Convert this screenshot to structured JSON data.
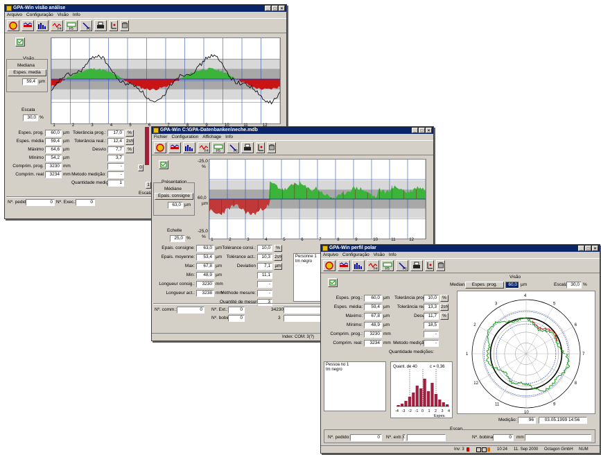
{
  "colors": {
    "title_bg": "#0a246a",
    "positive_fill": "#3cb43c",
    "negative_fill": "#c81414",
    "band_dark": "#a8a8a8",
    "band_light": "#d8d8d8",
    "line": "#101010"
  },
  "win1": {
    "title": "GPA-Win visão análise",
    "window_buttons": [
      "_",
      "□",
      "×"
    ],
    "menu": [
      "Arquivo",
      "Configuração",
      "Visão",
      "Info"
    ],
    "toolbar_icons": [
      "analysis-icon",
      "profile-icon",
      "bar-chart-icon",
      "f4-profile-icon",
      "f5-icon",
      "f6-icon",
      "print-icon",
      "axis-icon",
      "database-icon"
    ],
    "view_group": {
      "title": "Visão",
      "mode": "Mediana",
      "button": "Espes. media",
      "value": "59,4",
      "unit": "µm"
    },
    "scale": {
      "label": "Escala",
      "value": "30,0",
      "unit": "%"
    },
    "x_ticks": [
      "1",
      "2",
      "3",
      "4",
      "5",
      "6",
      "7",
      "8",
      "9",
      "10",
      "11",
      "12"
    ],
    "stats_left": [
      {
        "label": "Espes. prog.",
        "value": "60,0",
        "unit": "µm"
      },
      {
        "label": "Espes. média",
        "value": "59,4",
        "unit": "µm"
      },
      {
        "label": "Máximo",
        "value": "64,6",
        "unit": "µm"
      },
      {
        "label": "Mínimo",
        "value": "54,2",
        "unit": "µm"
      },
      {
        "label": "Comprim. prog.",
        "value": "3230",
        "unit": "mm"
      },
      {
        "label": "Comprim. real",
        "value": "3234",
        "unit": "mm"
      }
    ],
    "stats_right": [
      {
        "label": "Tolerância prog.:",
        "value": "17,0",
        "unit": "%"
      },
      {
        "label": "Tolerância real.:",
        "value": "12,4",
        "unit": "2s%"
      },
      {
        "label": "Desvio",
        "value": "7,7",
        "unit": "%"
      },
      {
        "label": "",
        "value": "3,7",
        "unit": ""
      },
      {
        "label": "",
        "value": "-",
        "unit": ""
      },
      {
        "label": "Metodo medição:",
        "value": "-",
        "unit": ""
      },
      {
        "label": "Quantidade medições:",
        "value": "1",
        "unit": ""
      }
    ],
    "bottom": {
      "n_pedido_label": "Nº. pedido:",
      "n_pedido_value": "0",
      "n_exec_label": "Nº. Exec.:",
      "n_exec_value": "0"
    },
    "side_labels": [
      "0",
      "1"
    ],
    "scale_side": "Escala"
  },
  "win2": {
    "title": "GPA-Win C:\\GPA-Datenbanken\\neche.mdb",
    "window_buttons": [
      "_",
      "□",
      "×"
    ],
    "menu": [
      "Fichier",
      "Configuration",
      "Affichage",
      "Info"
    ],
    "view_group": {
      "title": "Présentation",
      "mode": "Médiane",
      "button": "Epais. consigne",
      "value": "63,0",
      "unit": "µm"
    },
    "scale": {
      "label": "Echelle",
      "value": "25,0",
      "unit": "%"
    },
    "y_labels": {
      "top": "-25,0",
      "top_unit": "%",
      "mid": "60,0",
      "mid_unit": "µm",
      "bottom": "-25,0",
      "bottom_unit": "%"
    },
    "x_ticks": [
      "1",
      "2",
      "3",
      "4",
      "5",
      "6",
      "7",
      "8",
      "9",
      "10",
      "11",
      "12"
    ],
    "stats_left": [
      {
        "label": "Epais. consigne:",
        "value": "63,0",
        "unit": "µm"
      },
      {
        "label": "Epais. moyenne:",
        "value": "53,4",
        "unit": "µm"
      },
      {
        "label": "Max:",
        "value": "67,8",
        "unit": "µm"
      },
      {
        "label": "Min:",
        "value": "48,9",
        "unit": "µm"
      },
      {
        "label": "Longueur consig.:",
        "value": "3230",
        "unit": "mm"
      },
      {
        "label": "Longueur act.:",
        "value": "3238",
        "unit": "mm"
      }
    ],
    "stats_right": [
      {
        "label": "Tolérance consi.:",
        "value": "10,0",
        "unit": "%"
      },
      {
        "label": "Tolérance act.:",
        "value": "10,3",
        "unit": "2s%"
      },
      {
        "label": "Deviation",
        "value": "7,1",
        "unit": "µm"
      },
      {
        "label": "",
        "value": "11,1",
        "unit": ""
      },
      {
        "label": "",
        "value": "-",
        "unit": ""
      },
      {
        "label": "Méthode mesure:",
        "value": "-",
        "unit": ""
      },
      {
        "label": "Quantité de mesures:",
        "value": "3",
        "unit": ""
      }
    ],
    "memo": [
      "Personne 1",
      "trn négro"
    ],
    "bottom": {
      "n_commande_label": "Nº. comm.:",
      "n_commande_value": "0",
      "n_ext_label": "Nº. Ext.:",
      "n_ext_value": "0",
      "n_bobine_label": "Nº. bobine:",
      "n_bobine_value": "0",
      "field_a": "34230",
      "field_b": "3"
    },
    "status": "Index: COM: 3(?)"
  },
  "win3": {
    "title": "GPA-Win perfil polar",
    "window_buttons": [
      "_",
      "□",
      "×"
    ],
    "menu": [
      "Arquivo",
      "Configuração",
      "Visão",
      "Info"
    ],
    "view_group": {
      "title": "Visão",
      "mode": "Mediana",
      "button": "Espes. prog.",
      "value": "60,0",
      "unit": "µm",
      "scale_label": "Escala",
      "scale_value": "30,0",
      "scale_unit": "%"
    },
    "stats_left": [
      {
        "label": "Espes. prog.:",
        "value": "60,0",
        "unit": "µm"
      },
      {
        "label": "Espes. média:",
        "value": "59,4",
        "unit": "µm"
      },
      {
        "label": "Máximo:",
        "value": "67,8",
        "unit": "µm"
      },
      {
        "label": "Mínimo:",
        "value": "48,9",
        "unit": "µm"
      },
      {
        "label": "Comprim. prog.:",
        "value": "3230",
        "unit": "mm"
      },
      {
        "label": "Comprim. real:",
        "value": "3234",
        "unit": "mm"
      }
    ],
    "stats_right": [
      {
        "label": "Tolerância prog.:",
        "value": "10,0",
        "unit": "%"
      },
      {
        "label": "Tolerância real:",
        "value": "13,3",
        "unit": "2s%"
      },
      {
        "label": "Desvio",
        "value": "11,7",
        "unit": "%"
      },
      {
        "label": "",
        "value": "18,5",
        "unit": ""
      },
      {
        "label": "",
        "value": "-",
        "unit": ""
      },
      {
        "label": "Metodo medição:",
        "value": "-",
        "unit": ""
      },
      {
        "label": "Quantidade medições:",
        "value": "",
        "unit": ""
      }
    ],
    "memo": [
      "Pessoa no 1",
      "tm negro"
    ],
    "histogram": {
      "title": "Quant. de 40",
      "right_label": "c = 0,36",
      "x_ticks": [
        "-4",
        "-3",
        "-2",
        "-1",
        "0",
        "1",
        "2",
        "3",
        "4"
      ],
      "x_label": "Espes."
    },
    "polar_labels": [
      "1",
      "2",
      "3",
      "4",
      "5",
      "6",
      "7",
      "8",
      "9",
      "10",
      "11",
      "12"
    ],
    "measure": {
      "label": "Medição:",
      "value": "96",
      "date": "03.05.1999 14:56"
    },
    "scan_label": "Escan",
    "bottom": {
      "n_pedido_label": "Nº. pedido:",
      "n_pedido_value": "0",
      "n_extr_label": "Nº. extr.:",
      "n_extr_value": "0",
      "n_bobina_label": "Nº. bobina:",
      "n_bobina_value": "0",
      "mm_label": "mm"
    },
    "status": {
      "left": "Inv: 3",
      "time": "10:24",
      "date": "11. Sep 2000",
      "company": "Octagon GmbH",
      "num": "NUM"
    }
  }
}
